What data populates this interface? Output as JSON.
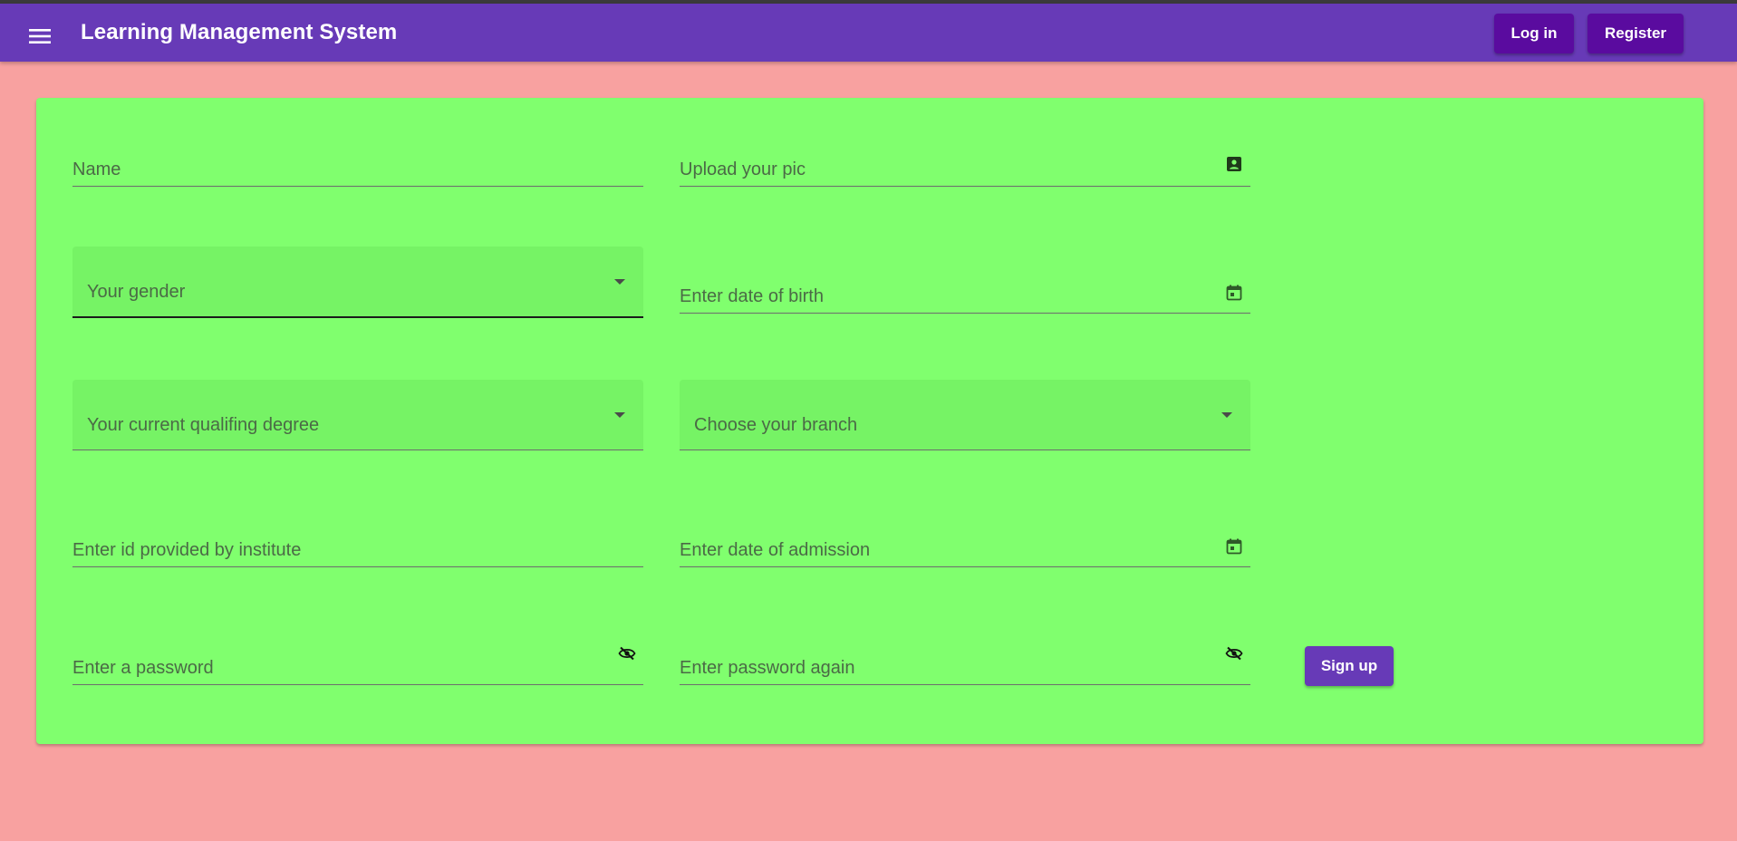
{
  "header": {
    "title": "Learning Management System",
    "menu_icon": "menu-icon",
    "login_label": "Log in",
    "register_label": "Register",
    "color": "#673ab7"
  },
  "form": {
    "name_label": "Name",
    "pic_label": "Upload your pic",
    "pic_icon": "account-box-icon",
    "gender_label": "Your gender",
    "dob_label": "Enter date of birth",
    "dob_icon": "calendar-icon",
    "degree_label": "Your current qualifing degree",
    "branch_label": "Choose your branch",
    "id_label": "Enter id provided by institute",
    "admission_label": "Enter date of admission",
    "admission_icon": "calendar-icon",
    "password_label": "Enter a password",
    "password_icon": "visibility-off-icon",
    "password_again_label": "Enter password again",
    "password_again_icon": "visibility-off-icon",
    "signup_label": "Sign up"
  },
  "colors": {
    "page_background": "#f8a1a0",
    "card_background": "#80ff6e",
    "button": "#673ab7",
    "nav_button": "#5a0b9f"
  }
}
